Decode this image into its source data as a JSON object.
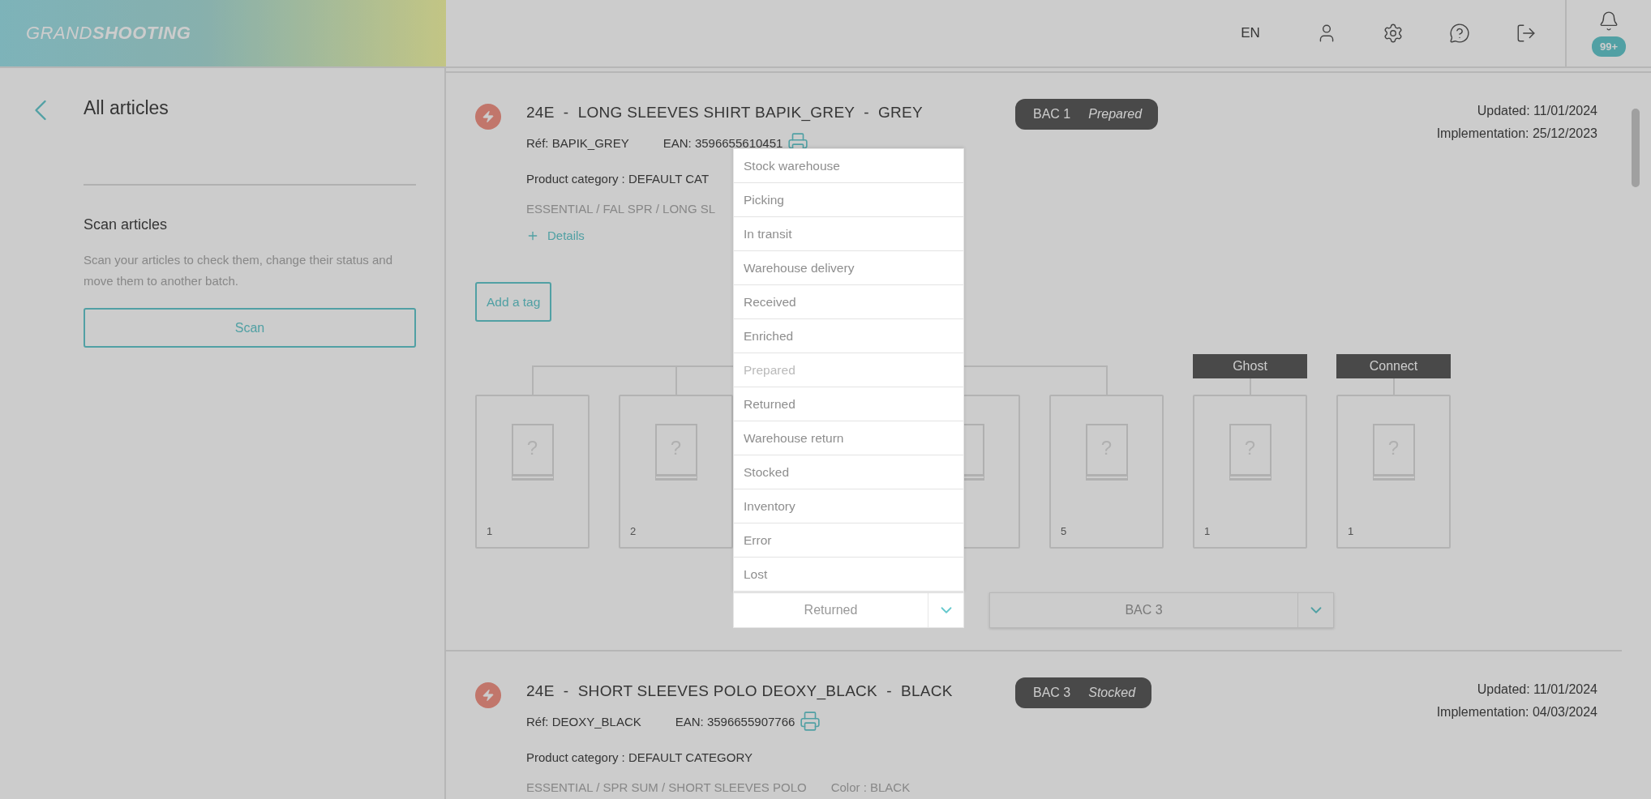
{
  "header": {
    "logo": "GRAND**SHOOTING**",
    "language": "EN",
    "notifications": {
      "badge": "99+"
    }
  },
  "sidebar": {
    "title": "All articles",
    "scan": {
      "title": "Scan articles",
      "description": "Scan your articles to check them, change their status and move them to another batch.",
      "button": "Scan"
    }
  },
  "articles": [
    {
      "title": "24E  -  LONG SLEEVES SHIRT BAPIK_GREY  -  GREY",
      "ref": "Réf: BAPIK_GREY",
      "ean": "EAN: 3596655610451",
      "category": "Product category : DEFAULT CAT",
      "path": "ESSENTIAL / FAL SPR / LONG SL",
      "details": "Details",
      "badge": {
        "batch": "BAC 1",
        "status": "Prepared"
      },
      "updated": "Updated: 11/01/2024",
      "implementation": "Implementation: 25/12/2023",
      "add_tag": "Add a tag",
      "slots": [
        {
          "kind": "branch",
          "mark": "?",
          "count": "1"
        },
        {
          "kind": "branch",
          "mark": "?",
          "count": "2"
        },
        {
          "kind": "covered"
        },
        {
          "kind": "branch"
        },
        {
          "kind": "branch",
          "mark": "?",
          "count": "5"
        },
        {
          "kind": "tagged",
          "tag": "Ghost",
          "mark": "?",
          "count": "1"
        },
        {
          "kind": "tagged",
          "tag": "Connect",
          "mark": "?",
          "count": "1"
        }
      ],
      "status_select": {
        "value": "Returned",
        "expanded": true,
        "options": [
          {
            "label": "Stock warehouse",
            "disabled": false
          },
          {
            "label": "Picking",
            "disabled": false
          },
          {
            "label": "In transit",
            "disabled": false
          },
          {
            "label": "Warehouse delivery",
            "disabled": false
          },
          {
            "label": "Received",
            "disabled": false
          },
          {
            "label": "Enriched",
            "disabled": false
          },
          {
            "label": "Prepared",
            "disabled": true
          },
          {
            "label": "Returned",
            "disabled": false
          },
          {
            "label": "Warehouse return",
            "disabled": false
          },
          {
            "label": "Stocked",
            "disabled": false
          },
          {
            "label": "Inventory",
            "disabled": false
          },
          {
            "label": "Error",
            "disabled": false
          },
          {
            "label": "Lost",
            "disabled": false
          }
        ]
      },
      "batch_select": {
        "value": "BAC 3"
      }
    },
    {
      "title": "24E  -  SHORT SLEEVES POLO DEOXY_BLACK  -  BLACK",
      "ref": "Réf: DEOXY_BLACK",
      "ean": "EAN: 3596655907766",
      "category": "Product category : DEFAULT CATEGORY",
      "path": "ESSENTIAL / SPR SUM / SHORT SLEEVES POLO",
      "color_label": "Color : BLACK",
      "badge": {
        "batch": "BAC 3",
        "status": "Stocked"
      },
      "updated": "Updated: 11/01/2024",
      "implementation": "Implementation: 04/03/2024"
    }
  ]
}
